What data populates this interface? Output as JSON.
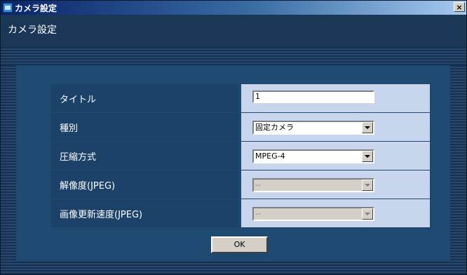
{
  "window": {
    "title": "カメラ設定",
    "close_glyph": "×"
  },
  "header": {
    "title": "カメラ設定"
  },
  "form": {
    "rows": [
      {
        "label": "タイトル",
        "type": "text",
        "value": "1"
      },
      {
        "label": "種別",
        "type": "select",
        "value": "固定カメラ",
        "disabled": false
      },
      {
        "label": "圧縮方式",
        "type": "select",
        "value": "MPEG-4",
        "disabled": false
      },
      {
        "label": "解像度(JPEG)",
        "type": "select",
        "value": "--",
        "disabled": true
      },
      {
        "label": "画像更新速度(JPEG)",
        "type": "select",
        "value": "--",
        "disabled": true
      }
    ]
  },
  "buttons": {
    "ok_label": "OK"
  },
  "colors": {
    "background": "#1b3756",
    "label_cell": "#1d4269",
    "value_cell": "#c7d6ec",
    "titlebar_start": "#0a246a"
  }
}
